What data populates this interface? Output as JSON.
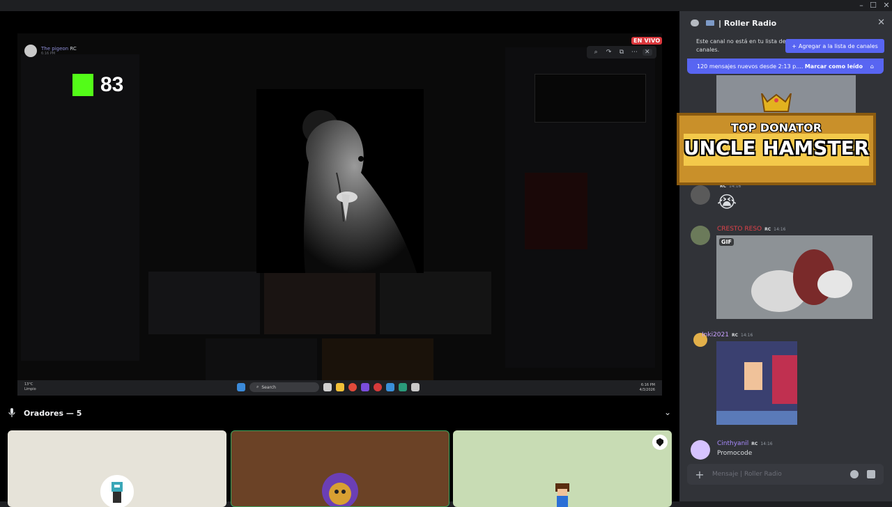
{
  "window_controls": {
    "minimize": "–",
    "maximize": "☐",
    "close": "✕"
  },
  "stream": {
    "live_badge": "EN VIVO",
    "streamer_name": "The pigeon",
    "streamer_time": "6:16 PM",
    "streamer_tag": "RC",
    "kick_viewers": "83",
    "taskbar": {
      "weather_temp": "13°C",
      "weather_desc": "Limpio",
      "search_label": "Search",
      "clock_time": "6:16 PM",
      "clock_date": "4/3/2026"
    }
  },
  "speakers": {
    "title": "Oradores — 5"
  },
  "side_panel": {
    "channel_name": "Roller Radio",
    "notice_text": "Este canal no está en tu lista de canales.",
    "add_button": "Agregar a la lista de canales",
    "new_messages": "120 mensajes nuevos desde 2:13 p....",
    "mark_read": "Marcar como leído",
    "donator_line1": "TOP DONATOR",
    "donator_line2": "UNCLE HAMSTER",
    "messages": [
      {
        "author": "",
        "time": "14:16",
        "tag": "RC",
        "content": "😭",
        "author_color": "#a45ede"
      },
      {
        "author": "CRESTO RESO",
        "time": "14:16",
        "tag": "RC",
        "gif_badge": "GIF",
        "author_color": "#e0424a"
      },
      {
        "author": "Inki2021",
        "time": "14:16",
        "tag": "RC",
        "author_color": "#c9a0ff"
      },
      {
        "author": "Cinthyanil",
        "time": "14:16",
        "tag": "RC",
        "content": "Promocode",
        "author_color": "#a98bff"
      }
    ],
    "composer_placeholder": "Mensaje  | Roller Radio"
  }
}
